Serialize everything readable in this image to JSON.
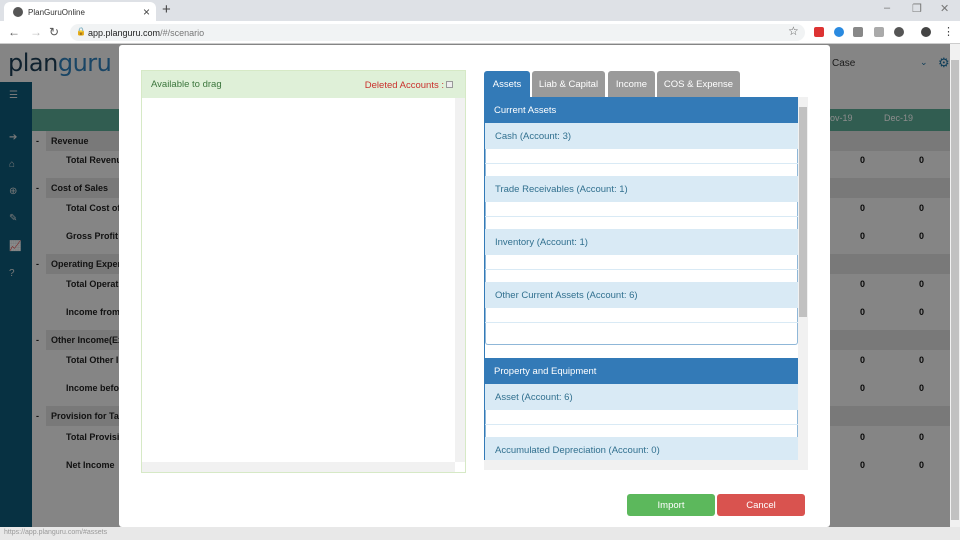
{
  "browser": {
    "tab_title": "PlanGuruOnline",
    "url_host": "app.planguru.com",
    "url_path": "/#/scenario",
    "status_url": "https://app.planguru.com/#assets"
  },
  "app": {
    "logo_dark": "plan",
    "logo_blue": "guru",
    "scenario_label": "Case",
    "columns": [
      "ov-19",
      "Dec-19"
    ],
    "rows": [
      {
        "label": "Revenue",
        "group": true
      },
      {
        "label": "Total Revenu",
        "values": [
          "0",
          "0"
        ]
      },
      {
        "label": "Cost of Sales",
        "group": true
      },
      {
        "label": "Total Cost of",
        "values": [
          "0",
          "0"
        ]
      },
      {
        "label": "Gross Profit",
        "values": [
          "0",
          "0"
        ]
      },
      {
        "label": "Operating Exper",
        "group": true
      },
      {
        "label": "Total Operati",
        "values": [
          "0",
          "0"
        ]
      },
      {
        "label": "Income from",
        "values": [
          "0",
          "0"
        ]
      },
      {
        "label": "Other Income(Ex",
        "group": true
      },
      {
        "label": "Total Other I",
        "values": [
          "0",
          "0"
        ]
      },
      {
        "label": "Income befo",
        "values": [
          "0",
          "0"
        ]
      },
      {
        "label": "Provision for Ta",
        "group": true
      },
      {
        "label": "Total Provisi",
        "values": [
          "0",
          "0"
        ]
      },
      {
        "label": "Net Income",
        "values": [
          "0",
          "0"
        ]
      }
    ]
  },
  "modal": {
    "left_title": "Available to drag",
    "deleted_label": "Deleted Accounts :",
    "tabs": [
      "Assets",
      "Liab & Capital",
      "Income",
      "COS & Expense"
    ],
    "groups": [
      {
        "title": "Current Assets",
        "items": [
          "Cash (Account: 3)",
          "Trade Receivables (Account: 1)",
          "Inventory (Account: 1)",
          "Other Current Assets (Account: 6)"
        ]
      },
      {
        "title": "Property and Equipment",
        "items": [
          "Asset (Account: 6)",
          "Accumulated Depreciation (Account: 0)"
        ]
      }
    ],
    "import_label": "Import",
    "cancel_label": "Cancel"
  },
  "colors": {
    "primary": "#337ab7",
    "success": "#5cb85c",
    "danger": "#d9534f",
    "sidebar": "#0d5a78"
  }
}
